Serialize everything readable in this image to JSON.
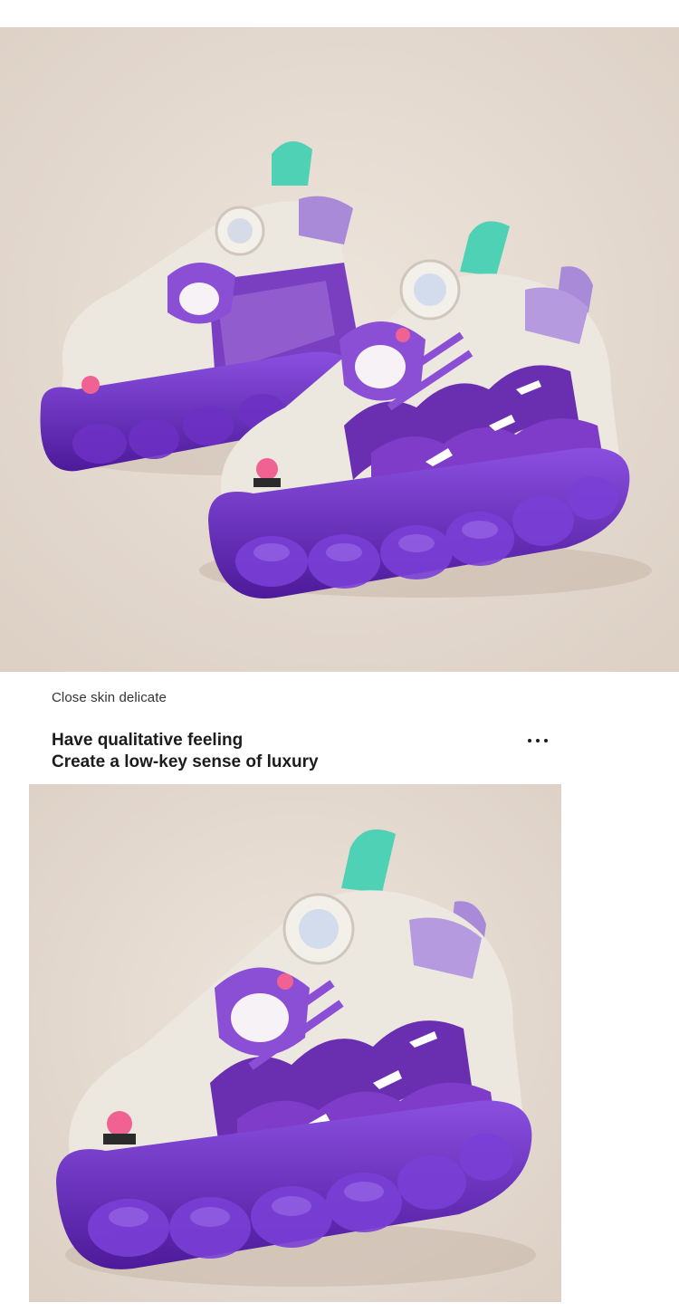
{
  "images": {
    "top_photo": {
      "icon": "purple-kids-sneakers-photo"
    },
    "bottom_photo": {
      "icon": "purple-kids-sneaker-photo"
    }
  },
  "section": {
    "subtitle": "Close skin delicate",
    "headline_line1": "Have qualitative feeling",
    "headline_line2": "Create a low-key sense of luxury",
    "more_icon": "ellipsis-icon"
  },
  "colors": {
    "photo_background": "#e7ddd4",
    "shoe_purple": "#6a2fb0",
    "shoe_cream": "#ece7df",
    "accent_mint": "#4fd1b5",
    "accent_pink": "#f06292"
  }
}
